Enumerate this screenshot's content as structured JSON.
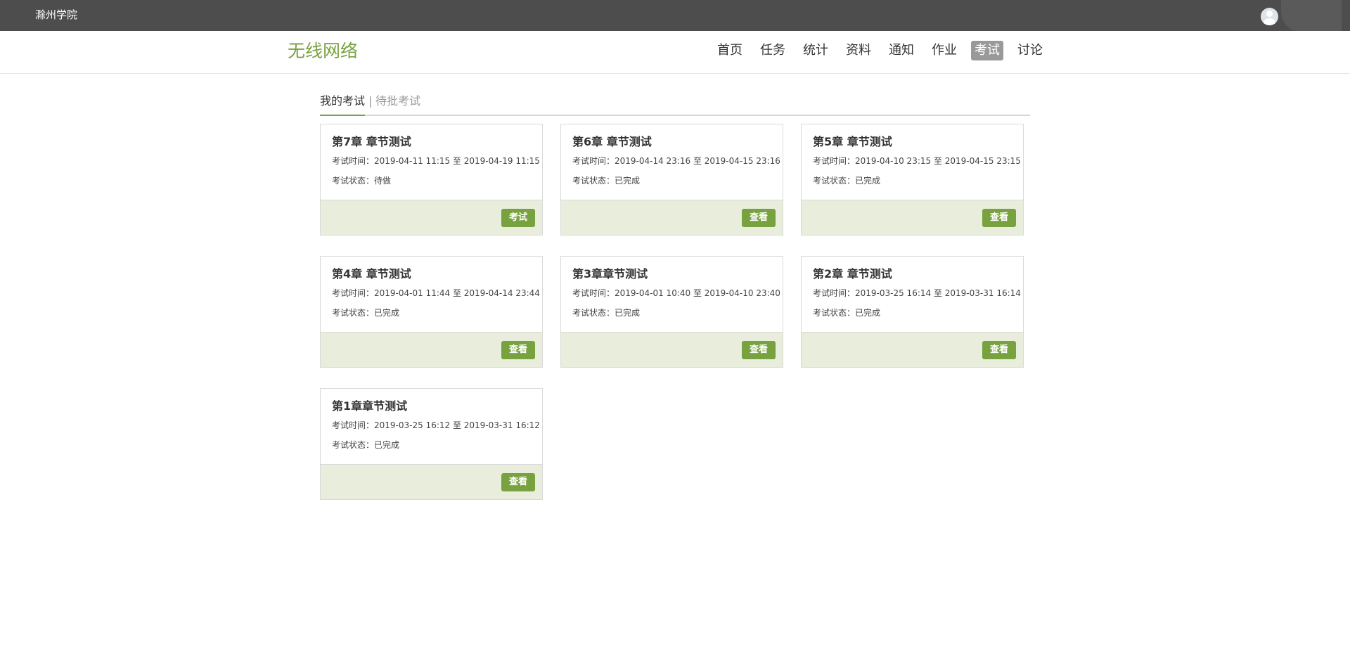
{
  "topbar": {
    "school_name": "滁州学院"
  },
  "course": {
    "title": "无线网络"
  },
  "nav": {
    "items": [
      "首页",
      "任务",
      "统计",
      "资料",
      "通知",
      "作业",
      "考试",
      "讨论"
    ],
    "active": "考试"
  },
  "tabs": {
    "mine": "我的考试",
    "separator": "|",
    "pending": "待批考试"
  },
  "exams": [
    {
      "title": "第7章 章节测试",
      "time": "考试时间：2019-04-11 11:15 至 2019-04-19 11:15",
      "status": "考试状态：待做",
      "button": "考试"
    },
    {
      "title": "第6章 章节测试",
      "time": "考试时间：2019-04-14 23:16 至 2019-04-15 23:16",
      "status": "考试状态：已完成",
      "button": "查看"
    },
    {
      "title": "第5章 章节测试",
      "time": "考试时间：2019-04-10 23:15 至 2019-04-15 23:15",
      "status": "考试状态：已完成",
      "button": "查看"
    },
    {
      "title": "第4章 章节测试",
      "time": "考试时间：2019-04-01 11:44 至 2019-04-14 23:44",
      "status": "考试状态：已完成",
      "button": "查看"
    },
    {
      "title": "第3章章节测试",
      "time": "考试时间：2019-04-01 10:40 至 2019-04-10 23:40",
      "status": "考试状态：已完成",
      "button": "查看"
    },
    {
      "title": "第2章 章节测试",
      "time": "考试时间：2019-03-25 16:14 至 2019-03-31 16:14",
      "status": "考试状态：已完成",
      "button": "查看"
    },
    {
      "title": "第1章章节测试",
      "time": "考试时间：2019-03-25 16:12 至 2019-03-31 16:12",
      "status": "考试状态：已完成",
      "button": "查看"
    }
  ],
  "colors": {
    "topbar": "#4d4d4d",
    "accent": "#78a13f",
    "card_footer": "#e8eddc",
    "nav_active": "#999999"
  }
}
